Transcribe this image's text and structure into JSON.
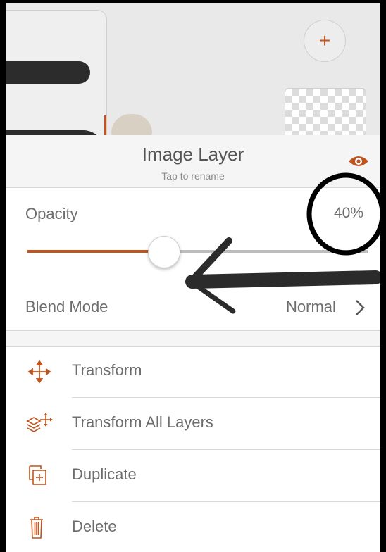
{
  "panel": {
    "title": "Image Layer",
    "subtitle": "Tap to rename",
    "visibility_icon": "eye-icon",
    "accent_color": "#c0541e"
  },
  "opacity": {
    "label": "Opacity",
    "value_text": "40%",
    "value": 0.4
  },
  "blend": {
    "label": "Blend Mode",
    "value": "Normal"
  },
  "menu": {
    "items": [
      {
        "label": "Transform",
        "icon": "move-arrows-icon"
      },
      {
        "label": "Transform All Layers",
        "icon": "transform-layers-icon"
      },
      {
        "label": "Duplicate",
        "icon": "duplicate-icon"
      },
      {
        "label": "Delete",
        "icon": "trash-icon"
      }
    ]
  },
  "canvas": {
    "add_button_glyph": "+"
  }
}
